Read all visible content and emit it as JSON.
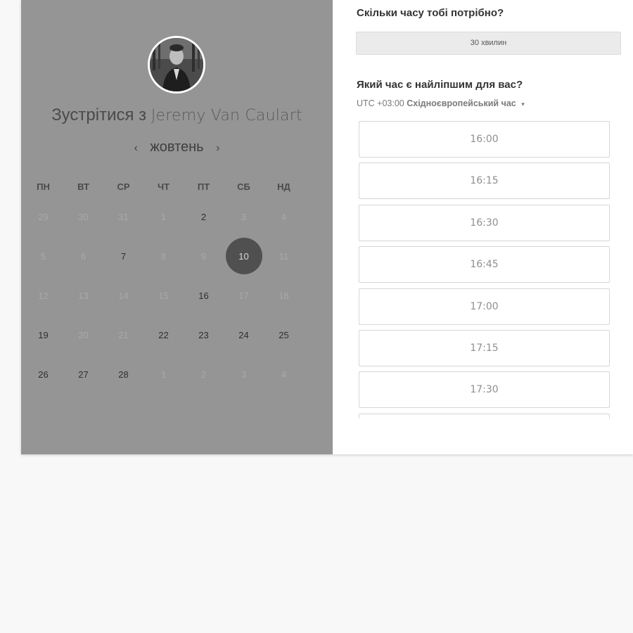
{
  "left_panel": {
    "title_prefix": "Зустрітися з",
    "host_name": "Jeremy Van Caulart",
    "month_label": "жовтень",
    "prev_arrow": "‹",
    "next_arrow": "›"
  },
  "calendar": {
    "weekdays": [
      "ПН",
      "ВТ",
      "СР",
      "ЧТ",
      "ПТ",
      "СБ",
      "НД"
    ],
    "weeks": [
      [
        {
          "d": "29",
          "s": "inactive"
        },
        {
          "d": "30",
          "s": "inactive"
        },
        {
          "d": "31",
          "s": "inactive"
        },
        {
          "d": "1",
          "s": "inactive"
        },
        {
          "d": "2",
          "s": "active"
        },
        {
          "d": "3",
          "s": "inactive"
        },
        {
          "d": "4",
          "s": "inactive"
        }
      ],
      [
        {
          "d": "5",
          "s": "inactive"
        },
        {
          "d": "6",
          "s": "inactive"
        },
        {
          "d": "7",
          "s": "active"
        },
        {
          "d": "8",
          "s": "inactive"
        },
        {
          "d": "9",
          "s": "inactive"
        },
        {
          "d": "10",
          "s": "selected"
        },
        {
          "d": "11",
          "s": "inactive"
        }
      ],
      [
        {
          "d": "12",
          "s": "inactive"
        },
        {
          "d": "13",
          "s": "inactive"
        },
        {
          "d": "14",
          "s": "inactive"
        },
        {
          "d": "15",
          "s": "inactive"
        },
        {
          "d": "16",
          "s": "active"
        },
        {
          "d": "17",
          "s": "inactive"
        },
        {
          "d": "18",
          "s": "inactive"
        }
      ],
      [
        {
          "d": "19",
          "s": "active"
        },
        {
          "d": "20",
          "s": "inactive"
        },
        {
          "d": "21",
          "s": "inactive"
        },
        {
          "d": "22",
          "s": "active"
        },
        {
          "d": "23",
          "s": "active"
        },
        {
          "d": "24",
          "s": "active"
        },
        {
          "d": "25",
          "s": "active"
        }
      ],
      [
        {
          "d": "26",
          "s": "active"
        },
        {
          "d": "27",
          "s": "active"
        },
        {
          "d": "28",
          "s": "active"
        },
        {
          "d": "1",
          "s": "inactive"
        },
        {
          "d": "2",
          "s": "inactive"
        },
        {
          "d": "3",
          "s": "inactive"
        },
        {
          "d": "4",
          "s": "inactive"
        }
      ]
    ]
  },
  "right_panel": {
    "duration_question": "Скільки часу тобі потрібно?",
    "duration_value": "30 хвилин",
    "time_question": "Який час є найліпшим для вас?",
    "timezone_offset": "UTC +03:00",
    "timezone_name": "Східноєвропейський час",
    "timezone_caret": "▾",
    "time_slots": [
      "16:00",
      "16:15",
      "16:30",
      "16:45",
      "17:00",
      "17:15",
      "17:30",
      ""
    ]
  },
  "icons": {
    "avatar": "host-avatar-photo",
    "caret": "caret-down-icon"
  },
  "colors": {
    "left_panel_bg": "#959595",
    "selected_day_bg": "#505050",
    "page_bg": "#f8f8f8"
  }
}
